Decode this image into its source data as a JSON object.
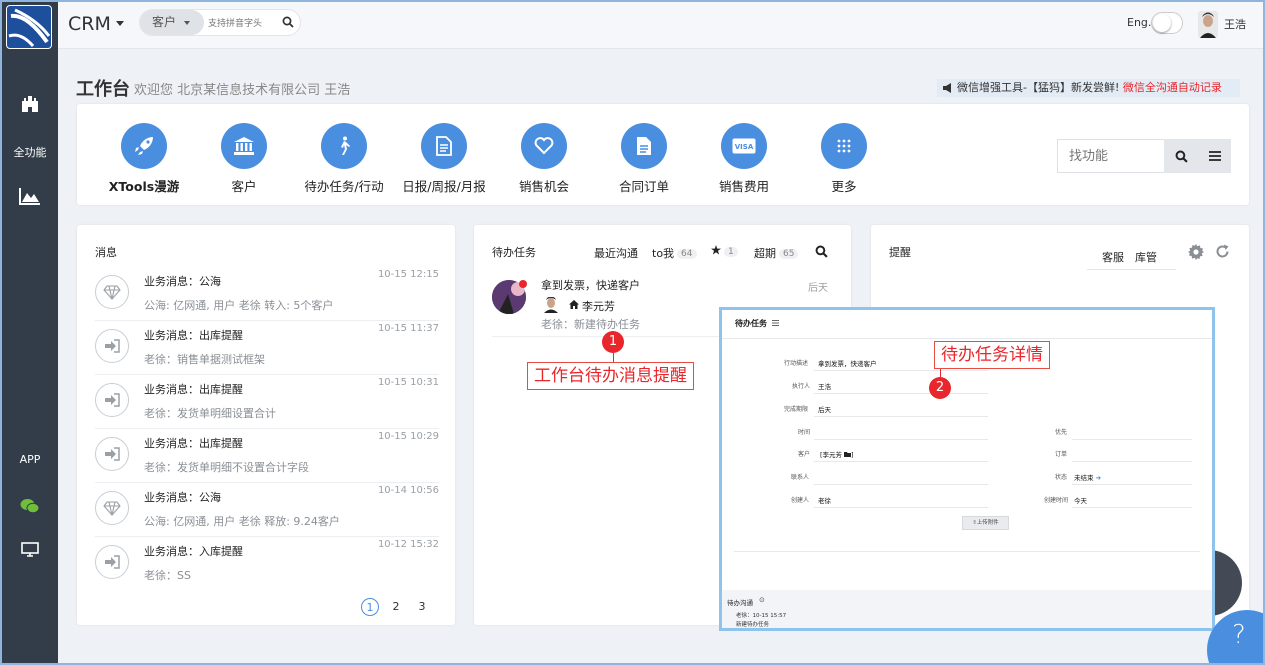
{
  "sidebar": {
    "items": [
      {
        "icon": "castle-icon",
        "label": ""
      },
      {
        "icon": "",
        "label": "全功能"
      },
      {
        "icon": "chart-icon",
        "label": ""
      },
      {
        "icon": "",
        "label": "APP"
      },
      {
        "icon": "wechat-icon",
        "label": ""
      },
      {
        "icon": "monitor-icon",
        "label": ""
      }
    ]
  },
  "header": {
    "app_title": "CRM",
    "search_scope": "客户",
    "search_placeholder": "支持拼音字头",
    "lang_label": "Eng.",
    "user_name": "王浩"
  },
  "page": {
    "title": "工作台",
    "welcome": "欢迎您 北京某信息技术有限公司 王浩",
    "promo_text": "微信增强工具-【猛犸】新发尝鲜!",
    "promo_highlight": "微信全沟通自动记录"
  },
  "functions": {
    "items": [
      {
        "label": "XTools漫游",
        "icon": "rocket-icon"
      },
      {
        "label": "客户",
        "icon": "bank-icon"
      },
      {
        "label": "待办任务/行动",
        "icon": "walking-icon"
      },
      {
        "label": "日报/周报/月报",
        "icon": "document-icon"
      },
      {
        "label": "销售机会",
        "icon": "heart-icon"
      },
      {
        "label": "合同订单",
        "icon": "file-icon"
      },
      {
        "label": "销售费用",
        "icon": "visa-icon"
      },
      {
        "label": "更多",
        "icon": "grid-icon"
      }
    ],
    "search_placeholder": "找功能"
  },
  "messages": {
    "title": "消息",
    "items": [
      {
        "title": "业务消息：公海",
        "sub": "公海: 亿网通, 用户 老徐 转入: 5个客户",
        "time": "10-15 12:15",
        "icon": "diamond-icon"
      },
      {
        "title": "业务消息：出库提醒",
        "sub": "老徐：销售单据测试框架",
        "time": "10-15 11:37",
        "icon": "sign-in-icon"
      },
      {
        "title": "业务消息：出库提醒",
        "sub": "老徐：发货单明细设置合计",
        "time": "10-15 10:31",
        "icon": "sign-in-icon"
      },
      {
        "title": "业务消息：出库提醒",
        "sub": "老徐：发货单明细不设置合计字段",
        "time": "10-15 10:29",
        "icon": "sign-in-icon"
      },
      {
        "title": "业务消息：公海",
        "sub": "公海: 亿网通, 用户 老徐 释放: 9.24客户",
        "time": "10-14 10:56",
        "icon": "diamond-icon"
      },
      {
        "title": "业务消息：入库提醒",
        "sub": "老徐：SS",
        "time": "10-12 15:32",
        "icon": "sign-in-icon"
      }
    ],
    "pages": [
      "1",
      "2",
      "3"
    ]
  },
  "tasks": {
    "title": "待办任务",
    "tabs": {
      "recent": "最近沟通",
      "to_me": "to我",
      "to_me_count": "64",
      "star_count": "1",
      "overdue": "超期",
      "overdue_count": "65"
    },
    "item": {
      "title": "拿到发票，快递客户",
      "time": "后天",
      "customer": "李元芳",
      "sub": "老徐：新建待办任务"
    }
  },
  "reminders": {
    "title": "提醒",
    "tabs": [
      "客服",
      "库管"
    ]
  },
  "detail": {
    "header": "待办任务",
    "fields": {
      "desc_label": "行动描述",
      "desc_value": "拿到发票，快递客户",
      "executor_label": "执行人",
      "executor_value": "王浩",
      "deadline_label": "完成期限",
      "deadline_value": "后天",
      "time_label": "时间",
      "priority_label": "优先",
      "customer_label": "客户",
      "customer_value": "[李元芳",
      "order_label": "订单",
      "contact_label": "联系人",
      "status_label": "状态",
      "status_value": "未结束",
      "creator_label": "创建人",
      "creator_value": "老徐",
      "created_label": "创建时间",
      "created_value": "今天"
    },
    "upload_button": "上传附件",
    "comm_title": "待办沟通",
    "comm_meta": "老徐：10-15 15:57",
    "comm_text": "新建待办任务"
  },
  "annotations": {
    "callout1": "工作台待办消息提醒",
    "num1": "1",
    "callout2": "待办任务详情",
    "num2": "2"
  },
  "colors": {
    "accent": "#4a8ee0",
    "sidebar": "#323d49",
    "alert": "#e8262b"
  }
}
